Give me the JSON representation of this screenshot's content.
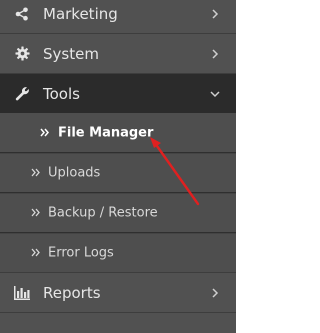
{
  "sidebar": {
    "items": [
      {
        "label": "Marketing",
        "icon": "share-icon"
      },
      {
        "label": "System",
        "icon": "gear-icon"
      },
      {
        "label": "Tools",
        "icon": "wrench-icon"
      },
      {
        "label": "Reports",
        "icon": "bar-chart-icon"
      }
    ],
    "tools_submenu": [
      {
        "label": "File Manager"
      },
      {
        "label": "Uploads"
      },
      {
        "label": "Backup / Restore"
      },
      {
        "label": "Error Logs"
      }
    ]
  },
  "colors": {
    "sidebar_bg": "#515151",
    "active_bg": "#2b2b2b",
    "text": "#e6e6e6",
    "annotation_arrow": "#e02020"
  }
}
